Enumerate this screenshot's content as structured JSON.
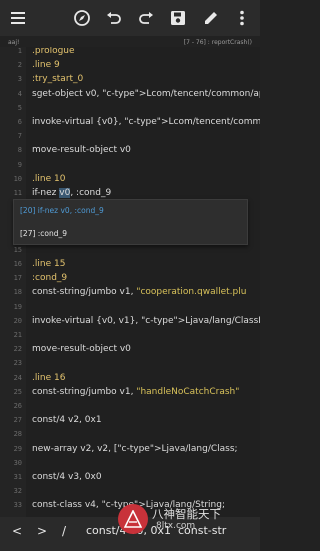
{
  "toolbar": {
    "icons": [
      "menu-icon",
      "compass-icon",
      "undo-icon",
      "redo-icon",
      "save-icon",
      "edit-icon",
      "more-icon"
    ]
  },
  "infobar": {
    "file": "aaj!",
    "position": "[7 - 76] : reportCrash()"
  },
  "editor": {
    "line_numbers": [
      "1",
      "2",
      "3",
      "4",
      "5",
      "6",
      "7",
      "8",
      "9",
      "10",
      "11",
      "12",
      "13",
      "14",
      "15",
      "16",
      "17",
      "18",
      "19",
      "20",
      "21",
      "22",
      "23",
      "24",
      "25",
      "26",
      "27",
      "28",
      "29",
      "30",
      "31",
      "32",
      "33"
    ],
    "lines": [
      ".prologue",
      ".line 9",
      ":try_start_0",
      "sget-object v0, Lcom/tencent/common/app/Bas",
      "",
      "invoke-virtual {v0}, Lcom/tencent/common/app/",
      "",
      "move-result-object v0",
      "",
      ".line 10",
      "if-nez v0, :cond_9",
      "",
      "",
      "",
      "",
      ".line 15",
      ":cond_9",
      "const-string/jumbo v1, \"cooperation.qwallet.plu",
      "",
      "invoke-virtual {v0, v1}, Ljava/lang/ClassLoader;",
      "",
      "move-result-object v0",
      "",
      ".line 16",
      "const-string/jumbo v1, \"handleNoCatchCrash\"",
      "",
      "const/4 v2, 0x1",
      "",
      "new-array v2, v2, [Ljava/lang/Class;",
      "",
      "const/4 v3, 0x0",
      "",
      "const-class v4, Ljava/lang/String;"
    ]
  },
  "popup": {
    "item1": "[20] if-nez v0, :cond_9",
    "item2": "[27] :cond_9"
  },
  "symbar": {
    "sym1": "<",
    "sym2": ">",
    "sym3": "/",
    "sym4": "const/4 v0, 0x1  const-str"
  },
  "watermark": {
    "line1": "八神智能天下",
    "line2": "8ltx.com"
  },
  "colors": {
    "background": "#222222",
    "toolbar": "#2b2b2b",
    "popup_highlight": "#4f9bd6",
    "accent_string": "#d7c15a"
  }
}
